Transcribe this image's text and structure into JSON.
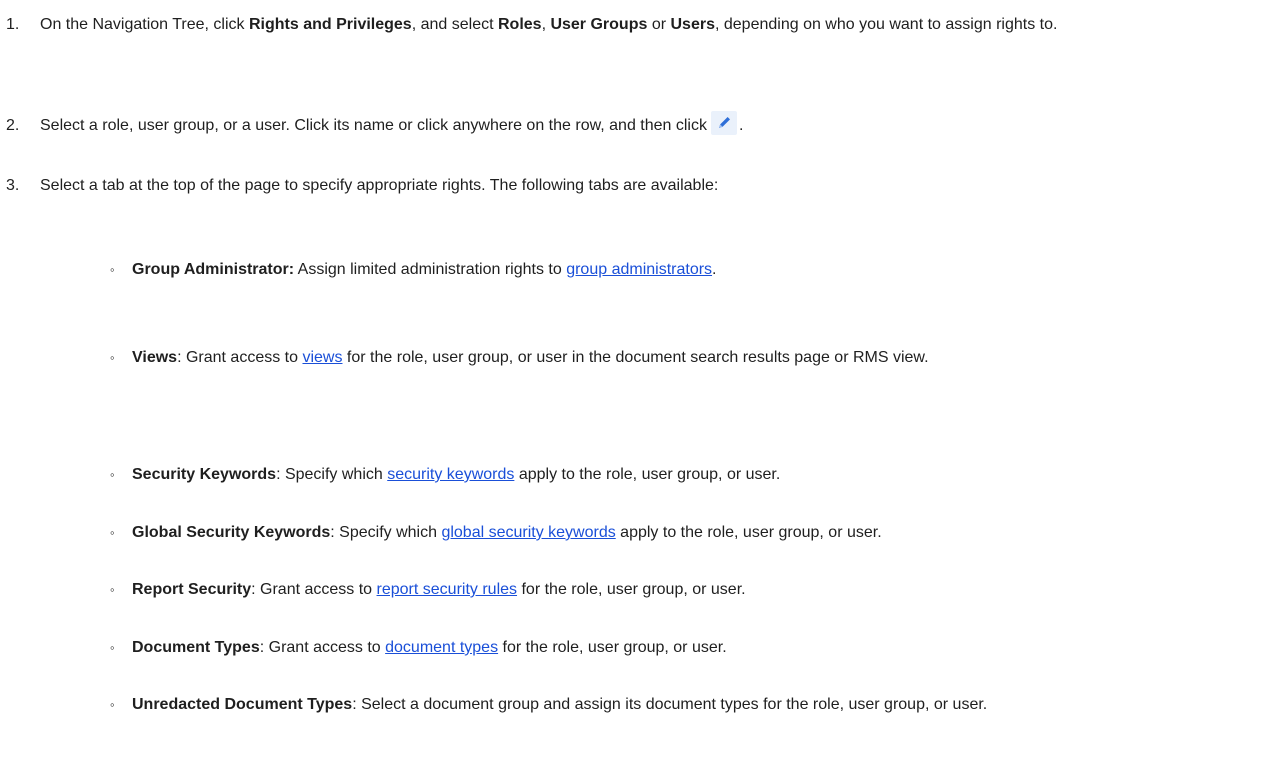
{
  "steps": [
    {
      "number": "1.",
      "t1": "On the Navigation Tree, click ",
      "b1": "Rights and Privileges",
      "t2": ", and select ",
      "b2": "Roles",
      "t3": ", ",
      "b3": "User Groups",
      "t4": " or ",
      "b4": "Users",
      "t5": ", depending on who you want to assign rights to."
    },
    {
      "number": "2.",
      "t1": "Select a role, user group, or a user. Click its name or click anywhere on the row, and then click",
      "icon": "pencil-edit-icon",
      "t2": "."
    },
    {
      "number": "3.",
      "t1": "Select a tab at the top of the page to specify appropriate rights. The following tabs are available:"
    }
  ],
  "tabs": [
    {
      "mark": "◦",
      "label": "Group Administrator:",
      "before": " Assign limited administration rights to ",
      "link": "group administrators",
      "after": "."
    },
    {
      "mark": "◦",
      "label": "Views",
      "before": ": Grant access to ",
      "link": "views",
      "after": " for the role, user group, or user in the document search results page or RMS view."
    },
    {
      "mark": "◦",
      "label": "Security Keywords",
      "before": ": Specify which ",
      "link": "security keywords",
      "after": " apply to the role, user group, or user."
    },
    {
      "mark": "◦",
      "label": "Global Security Keywords",
      "before": ": Specify which ",
      "link": "global security keywords",
      "after": " apply to the role, user group, or user."
    },
    {
      "mark": "◦",
      "label": "Report Security",
      "before": ": Grant access to ",
      "link": "report security rules",
      "after": " for the role, user group, or user."
    },
    {
      "mark": "◦",
      "label": "Document Types",
      "before": ": Grant access to ",
      "link": "document types",
      "after": " for the role, user group, or user."
    },
    {
      "mark": "◦",
      "label": "Unredacted Document Types",
      "before": ": Select a document group and assign its document types for the role, user group, or user.",
      "link": "",
      "after": ""
    }
  ],
  "colors": {
    "link": "#1a4fd8",
    "text": "#1f1f1f",
    "icon_bg": "#eaf1fb",
    "icon_pen": "#2f6fd8"
  }
}
